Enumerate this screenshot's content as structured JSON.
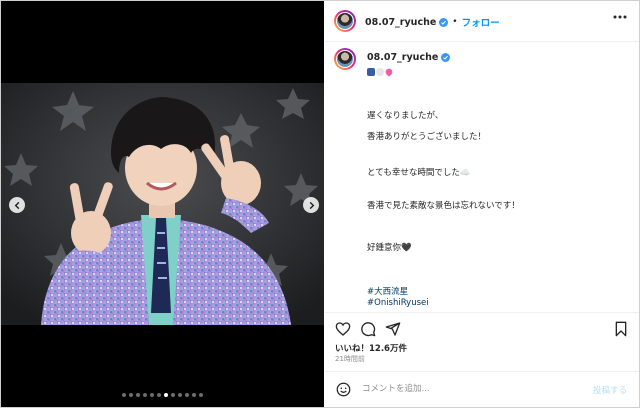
{
  "header": {
    "username": "08.07_ryuche",
    "separator": "•",
    "follow_label": "フォロー"
  },
  "caption": {
    "username": "08.07_ryuche",
    "lines": [
      "遅くなりましたが、",
      "香港ありがとうございました！",
      "とても幸せな時間でした☁️",
      "香港で見た素敵な景色は忘れないです！",
      "好鍾意你🖤"
    ],
    "hashtags": [
      "#大西流星",
      "#OnishiRyusei"
    ]
  },
  "stats": {
    "likes": "いいね！12.6万件",
    "time": "21時間前"
  },
  "comment": {
    "placeholder": "コメントを追加...",
    "post_label": "投稿する"
  },
  "carousel": {
    "total": 12,
    "active_index": 6
  },
  "colors": {
    "accent": "#0095f6",
    "verified": "#3897f0",
    "hashtag": "#00376b"
  },
  "icons": [
    "chevron-left-icon",
    "chevron-right-icon",
    "verified-icon",
    "more-icon",
    "heart-icon",
    "comment-icon",
    "share-icon",
    "bookmark-icon",
    "emoji-icon"
  ]
}
